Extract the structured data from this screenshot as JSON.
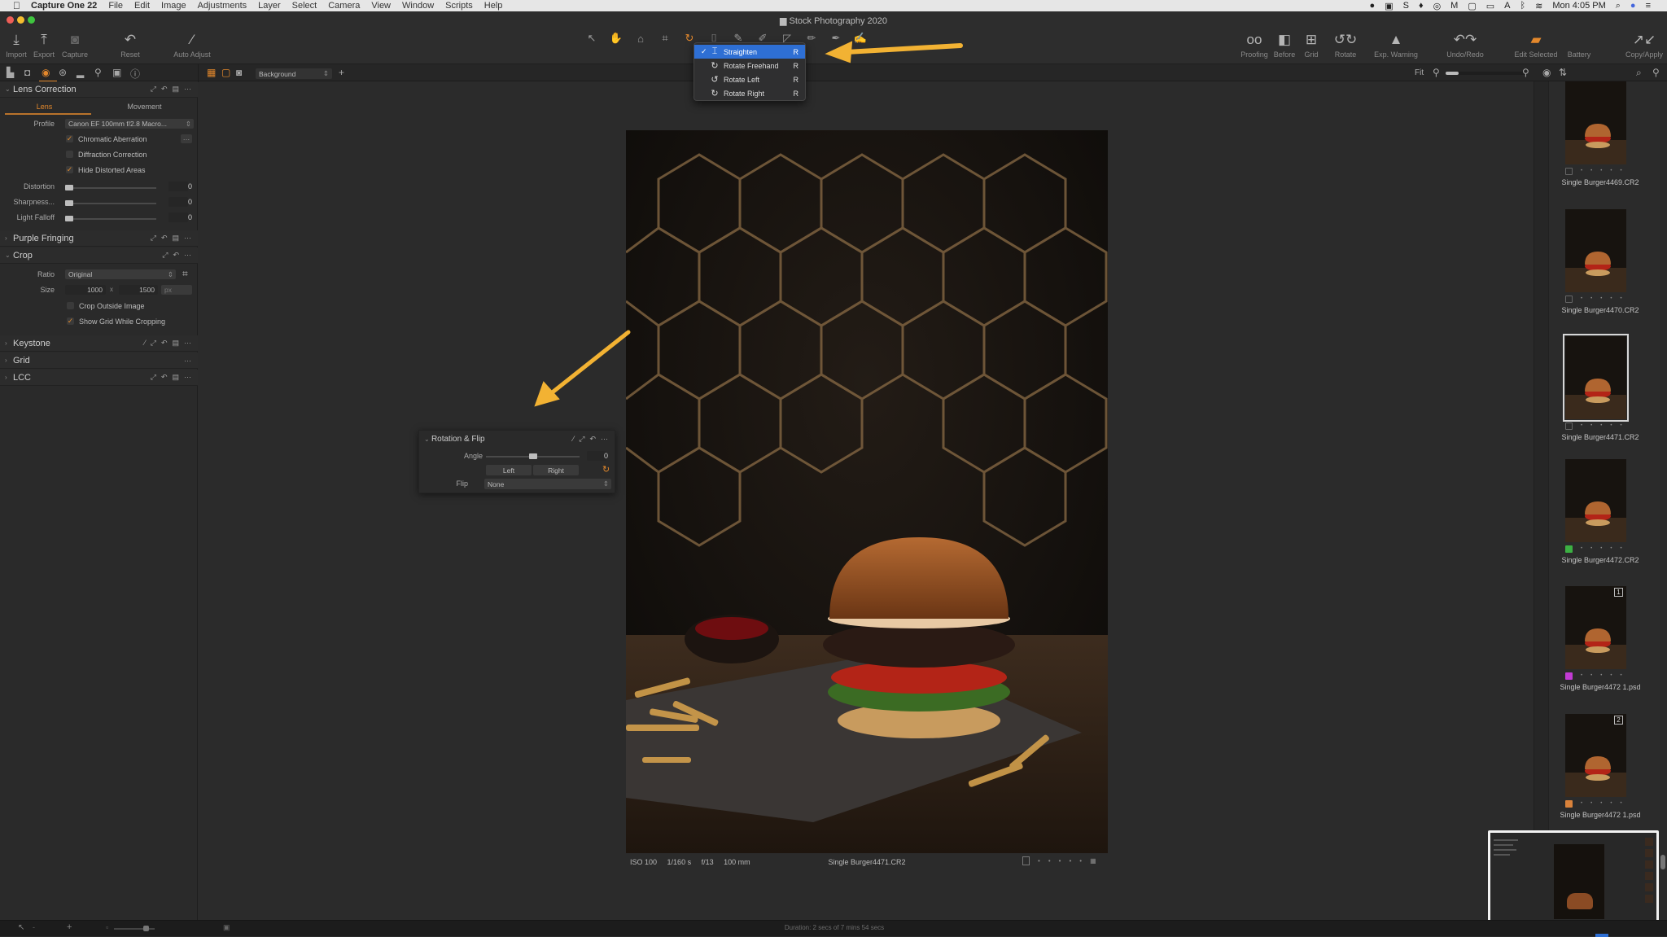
{
  "menubar": {
    "app_name": "Capture One 22",
    "items": [
      "File",
      "Edit",
      "Image",
      "Adjustments",
      "Layer",
      "Select",
      "Camera",
      "View",
      "Window",
      "Scripts",
      "Help"
    ],
    "clock": "Mon 4:05 PM"
  },
  "window": {
    "title": "Stock Photography 2020"
  },
  "toolbar_left": [
    {
      "icon": "import-icon",
      "label": "Import"
    },
    {
      "icon": "export-icon",
      "label": "Export"
    },
    {
      "icon": "capture-icon",
      "label": "Capture"
    },
    {
      "icon": "reset-icon",
      "label": "Reset"
    },
    {
      "icon": "auto-adjust-icon",
      "label": "Auto Adjust"
    }
  ],
  "toolbar_right": [
    {
      "icon": "proofing-icon",
      "label": "Proofing"
    },
    {
      "icon": "before-icon",
      "label": "Before"
    },
    {
      "icon": "grid-icon",
      "label": "Grid"
    },
    {
      "icon": "rotate-icon",
      "label": "Rotate"
    },
    {
      "icon": "exposure-warning-icon",
      "label": "Exp. Warning"
    },
    {
      "icon": "undo-redo-icon",
      "label": "Undo/Redo"
    },
    {
      "icon": "edit-selected-icon",
      "label": "Edit Selected"
    },
    {
      "icon": "battery-icon",
      "label": "Battery"
    },
    {
      "icon": "copy-apply-icon",
      "label": "Copy/Apply"
    }
  ],
  "rotate_menu": {
    "items": [
      {
        "label": "Straighten",
        "shortcut": "R",
        "checked": true,
        "selected": true
      },
      {
        "label": "Rotate Freehand",
        "shortcut": "R",
        "checked": false,
        "selected": false
      },
      {
        "label": "Rotate Left",
        "shortcut": "R",
        "checked": false,
        "selected": false
      },
      {
        "label": "Rotate Right",
        "shortcut": "R",
        "checked": false,
        "selected": false
      }
    ]
  },
  "subbar": {
    "layer_select": "Background",
    "fit_label": "Fit"
  },
  "lens_correction": {
    "title": "Lens Correction",
    "tabs": [
      "Lens",
      "Movement"
    ],
    "active_tab": "Lens",
    "profile_label": "Profile",
    "profile_value": "Canon EF 100mm f/2.8 Macro...",
    "checkboxes": [
      {
        "label": "Chromatic Aberration",
        "checked": true
      },
      {
        "label": "Diffraction Correction",
        "checked": false
      },
      {
        "label": "Hide Distorted Areas",
        "checked": true
      }
    ],
    "sliders": [
      {
        "label": "Distortion",
        "value": "0"
      },
      {
        "label": "Sharpness...",
        "value": "0"
      },
      {
        "label": "Light Falloff",
        "value": "0"
      }
    ]
  },
  "purple_fringing": {
    "title": "Purple Fringing"
  },
  "crop": {
    "title": "Crop",
    "ratio_label": "Ratio",
    "ratio_value": "Original",
    "size_label": "Size",
    "width": "1000",
    "x": "x",
    "height": "1500",
    "unit": "px",
    "checkboxes": [
      {
        "label": "Crop Outside Image",
        "checked": false
      },
      {
        "label": "Show Grid While Cropping",
        "checked": true
      }
    ]
  },
  "keystone": {
    "title": "Keystone"
  },
  "grid": {
    "title": "Grid"
  },
  "lcc": {
    "title": "LCC"
  },
  "rotation_flip": {
    "title": "Rotation & Flip",
    "angle_label": "Angle",
    "angle_value": "0",
    "angle_fraction": 0.5,
    "left_label": "Left",
    "right_label": "Right",
    "flip_label": "Flip",
    "flip_value": "None"
  },
  "viewer": {
    "iso": "ISO 100",
    "shutter": "1/160 s",
    "aperture": "f/13",
    "focal": "100 mm",
    "filename": "Single Burger4471.CR2"
  },
  "filmstrip": [
    {
      "name": "Single Burger4469.CR2",
      "color_tag": "",
      "selected": false,
      "badge": ""
    },
    {
      "name": "Single Burger4470.CR2",
      "color_tag": "",
      "selected": false,
      "badge": ""
    },
    {
      "name": "Single Burger4471.CR2",
      "color_tag": "",
      "selected": true,
      "badge": ""
    },
    {
      "name": "Single Burger4472.CR2",
      "color_tag": "#3cb043",
      "selected": false,
      "badge": ""
    },
    {
      "name": "Single Burger4472 1.psd",
      "color_tag": "#c23bd4",
      "selected": false,
      "badge": "1"
    },
    {
      "name": "Single Burger4472 1.psd",
      "color_tag": "#d9823b",
      "selected": false,
      "badge": "2"
    }
  ],
  "status": {
    "duration": "Duration: 2 secs of 7 mins 54 secs"
  },
  "colors": {
    "accent": "#e3882c",
    "menu_selected": "#2e6fd4",
    "arrow": "#f2b233"
  }
}
